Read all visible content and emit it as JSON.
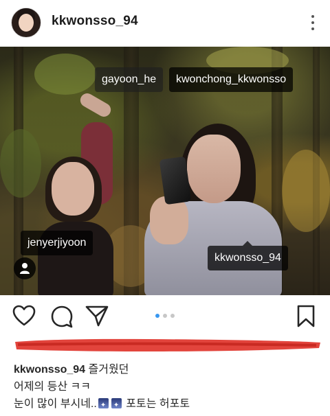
{
  "post": {
    "username": "kkwonsso_94"
  },
  "photo": {
    "tags": {
      "gayoon": "gayoon_he",
      "kwonchong": "kwonchong_kkwonsso",
      "jenyer": "jenyerjiyoon",
      "kwonsso": "kkwonsso_94"
    }
  },
  "carousel": {
    "count": 3,
    "active_index": 0
  },
  "caption": {
    "username": "kkwonsso_94",
    "line1": "즐거웠던",
    "line2": "어제의 등산 ㅋㅋ",
    "line3_a": "눈이 많이 부시네..",
    "line3_b": "포토는 허포토"
  },
  "icons": {
    "more": "more-vertical-icon",
    "heart": "heart-icon",
    "comment": "comment-icon",
    "share": "share-icon",
    "bookmark": "bookmark-icon",
    "user_tags": "user-tag-icon"
  },
  "colors": {
    "accent_dot": "#3897f0",
    "scribble": "#e0342b"
  }
}
